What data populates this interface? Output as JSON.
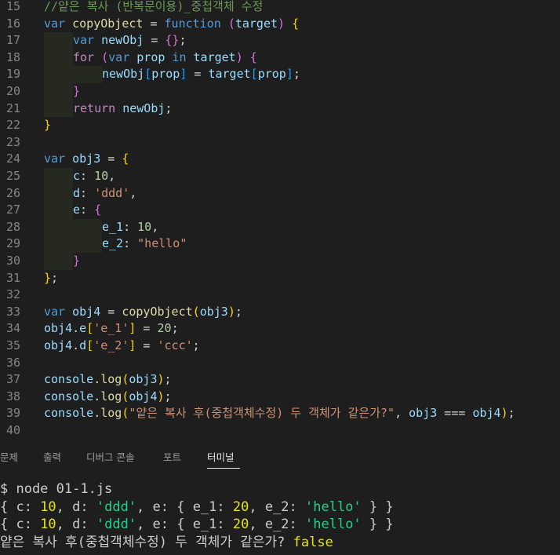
{
  "editor": {
    "lines": [
      {
        "num": "15",
        "tokens": [
          {
            "t": "//얕은 복사 (반복문이용)_중첩객체 수정",
            "c": "c"
          }
        ]
      },
      {
        "num": "16",
        "tokens": [
          {
            "t": "var ",
            "c": "k"
          },
          {
            "t": "copyObject",
            "c": "f"
          },
          {
            "t": " = ",
            "c": "p"
          },
          {
            "t": "function",
            "c": "k"
          },
          {
            "t": " ",
            "c": "p"
          },
          {
            "t": "(",
            "c": "b2"
          },
          {
            "t": "target",
            "c": "v"
          },
          {
            "t": ")",
            "c": "b2"
          },
          {
            "t": " ",
            "c": "p"
          },
          {
            "t": "{",
            "c": "b1"
          }
        ]
      },
      {
        "num": "17",
        "tokens": [
          {
            "t": "var ",
            "c": "k"
          },
          {
            "t": "newObj",
            "c": "v"
          },
          {
            "t": " = ",
            "c": "p"
          },
          {
            "t": "{}",
            "c": "b2"
          },
          {
            "t": ";",
            "c": "p"
          }
        ],
        "indent": 1
      },
      {
        "num": "18",
        "tokens": [
          {
            "t": "for",
            "c": "kw"
          },
          {
            "t": " ",
            "c": "p"
          },
          {
            "t": "(",
            "c": "b2"
          },
          {
            "t": "var ",
            "c": "k"
          },
          {
            "t": "prop",
            "c": "v"
          },
          {
            "t": " in ",
            "c": "k"
          },
          {
            "t": "target",
            "c": "v"
          },
          {
            "t": ")",
            "c": "b2"
          },
          {
            "t": " ",
            "c": "p"
          },
          {
            "t": "{",
            "c": "b2"
          }
        ],
        "indent": 1
      },
      {
        "num": "19",
        "tokens": [
          {
            "t": "newObj",
            "c": "v"
          },
          {
            "t": "[",
            "c": "b3"
          },
          {
            "t": "prop",
            "c": "v"
          },
          {
            "t": "]",
            "c": "b3"
          },
          {
            "t": " = ",
            "c": "p"
          },
          {
            "t": "target",
            "c": "v"
          },
          {
            "t": "[",
            "c": "b3"
          },
          {
            "t": "prop",
            "c": "v"
          },
          {
            "t": "]",
            "c": "b3"
          },
          {
            "t": ";",
            "c": "p"
          }
        ],
        "indent": 2
      },
      {
        "num": "20",
        "tokens": [
          {
            "t": "}",
            "c": "b2"
          }
        ],
        "indent": 1
      },
      {
        "num": "21",
        "tokens": [
          {
            "t": "return",
            "c": "kw"
          },
          {
            "t": " ",
            "c": "p"
          },
          {
            "t": "newObj",
            "c": "v"
          },
          {
            "t": ";",
            "c": "p"
          }
        ],
        "indent": 1
      },
      {
        "num": "22",
        "tokens": [
          {
            "t": "}",
            "c": "b1"
          }
        ]
      },
      {
        "num": "23",
        "tokens": []
      },
      {
        "num": "24",
        "tokens": [
          {
            "t": "var ",
            "c": "k"
          },
          {
            "t": "obj3",
            "c": "v"
          },
          {
            "t": " = ",
            "c": "p"
          },
          {
            "t": "{",
            "c": "b1"
          }
        ]
      },
      {
        "num": "25",
        "tokens": [
          {
            "t": "c",
            "c": "v"
          },
          {
            "t": ": ",
            "c": "p"
          },
          {
            "t": "10",
            "c": "n"
          },
          {
            "t": ",",
            "c": "p"
          }
        ],
        "indent": 1
      },
      {
        "num": "26",
        "tokens": [
          {
            "t": "d",
            "c": "v"
          },
          {
            "t": ": ",
            "c": "p"
          },
          {
            "t": "'ddd'",
            "c": "s"
          },
          {
            "t": ",",
            "c": "p"
          }
        ],
        "indent": 1
      },
      {
        "num": "27",
        "tokens": [
          {
            "t": "e",
            "c": "v"
          },
          {
            "t": ": ",
            "c": "p"
          },
          {
            "t": "{",
            "c": "b2"
          }
        ],
        "indent": 1
      },
      {
        "num": "28",
        "tokens": [
          {
            "t": "e_1",
            "c": "v"
          },
          {
            "t": ": ",
            "c": "p"
          },
          {
            "t": "10",
            "c": "n"
          },
          {
            "t": ",",
            "c": "p"
          }
        ],
        "indent": 2
      },
      {
        "num": "29",
        "tokens": [
          {
            "t": "e_2",
            "c": "v"
          },
          {
            "t": ": ",
            "c": "p"
          },
          {
            "t": "\"hello\"",
            "c": "s"
          }
        ],
        "indent": 2
      },
      {
        "num": "30",
        "tokens": [
          {
            "t": "}",
            "c": "b2"
          }
        ],
        "indent": 1
      },
      {
        "num": "31",
        "tokens": [
          {
            "t": "}",
            "c": "b1"
          },
          {
            "t": ";",
            "c": "p"
          }
        ]
      },
      {
        "num": "32",
        "tokens": []
      },
      {
        "num": "33",
        "tokens": [
          {
            "t": "var ",
            "c": "k"
          },
          {
            "t": "obj4",
            "c": "v"
          },
          {
            "t": " = ",
            "c": "p"
          },
          {
            "t": "copyObject",
            "c": "f"
          },
          {
            "t": "(",
            "c": "b1"
          },
          {
            "t": "obj3",
            "c": "v"
          },
          {
            "t": ")",
            "c": "b1"
          },
          {
            "t": ";",
            "c": "p"
          }
        ]
      },
      {
        "num": "34",
        "tokens": [
          {
            "t": "obj4",
            "c": "v"
          },
          {
            "t": ".",
            "c": "p"
          },
          {
            "t": "e",
            "c": "v"
          },
          {
            "t": "[",
            "c": "b1"
          },
          {
            "t": "'e_1'",
            "c": "s"
          },
          {
            "t": "]",
            "c": "b1"
          },
          {
            "t": " = ",
            "c": "p"
          },
          {
            "t": "20",
            "c": "n"
          },
          {
            "t": ";",
            "c": "p"
          }
        ]
      },
      {
        "num": "35",
        "tokens": [
          {
            "t": "obj4",
            "c": "v"
          },
          {
            "t": ".",
            "c": "p"
          },
          {
            "t": "d",
            "c": "v"
          },
          {
            "t": "[",
            "c": "b1"
          },
          {
            "t": "'e_2'",
            "c": "s"
          },
          {
            "t": "]",
            "c": "b1"
          },
          {
            "t": " = ",
            "c": "p"
          },
          {
            "t": "'ccc'",
            "c": "s"
          },
          {
            "t": ";",
            "c": "p"
          }
        ]
      },
      {
        "num": "36",
        "tokens": []
      },
      {
        "num": "37",
        "tokens": [
          {
            "t": "console",
            "c": "v"
          },
          {
            "t": ".",
            "c": "p"
          },
          {
            "t": "log",
            "c": "f"
          },
          {
            "t": "(",
            "c": "b1"
          },
          {
            "t": "obj3",
            "c": "v"
          },
          {
            "t": ")",
            "c": "b1"
          },
          {
            "t": ";",
            "c": "p"
          }
        ]
      },
      {
        "num": "38",
        "tokens": [
          {
            "t": "console",
            "c": "v"
          },
          {
            "t": ".",
            "c": "p"
          },
          {
            "t": "log",
            "c": "f"
          },
          {
            "t": "(",
            "c": "b1"
          },
          {
            "t": "obj4",
            "c": "v"
          },
          {
            "t": ")",
            "c": "b1"
          },
          {
            "t": ";",
            "c": "p"
          }
        ]
      },
      {
        "num": "39",
        "tokens": [
          {
            "t": "console",
            "c": "v"
          },
          {
            "t": ".",
            "c": "p"
          },
          {
            "t": "log",
            "c": "f"
          },
          {
            "t": "(",
            "c": "b1"
          },
          {
            "t": "\"얕은 복사 후(중첩객체수정) 두 객체가 같은가?\"",
            "c": "s"
          },
          {
            "t": ", ",
            "c": "p"
          },
          {
            "t": "obj3",
            "c": "v"
          },
          {
            "t": " === ",
            "c": "p"
          },
          {
            "t": "obj4",
            "c": "v"
          },
          {
            "t": ")",
            "c": "b1"
          },
          {
            "t": ";",
            "c": "p"
          }
        ]
      },
      {
        "num": "40",
        "tokens": []
      }
    ]
  },
  "panel": {
    "tabs": [
      {
        "label": "문제",
        "active": false
      },
      {
        "label": "출력",
        "active": false
      },
      {
        "label": "디버그 콘솔",
        "active": false
      },
      {
        "label": "포트",
        "active": false
      },
      {
        "label": "터미널",
        "active": true
      }
    ]
  },
  "terminal": {
    "lines": [
      [
        {
          "t": "$ node 01-1.js",
          "c": ""
        }
      ],
      [
        {
          "t": "{ c: ",
          "c": ""
        },
        {
          "t": "10",
          "c": "t-num"
        },
        {
          "t": ", d: ",
          "c": ""
        },
        {
          "t": "'ddd'",
          "c": "t-str"
        },
        {
          "t": ", e: { e_1: ",
          "c": ""
        },
        {
          "t": "20",
          "c": "t-num"
        },
        {
          "t": ", e_2: ",
          "c": ""
        },
        {
          "t": "'hello'",
          "c": "t-str"
        },
        {
          "t": " } }",
          "c": ""
        }
      ],
      [
        {
          "t": "{ c: ",
          "c": ""
        },
        {
          "t": "10",
          "c": "t-num"
        },
        {
          "t": ", d: ",
          "c": ""
        },
        {
          "t": "'ddd'",
          "c": "t-str"
        },
        {
          "t": ", e: { e_1: ",
          "c": ""
        },
        {
          "t": "20",
          "c": "t-num"
        },
        {
          "t": ", e_2: ",
          "c": ""
        },
        {
          "t": "'hello'",
          "c": "t-str"
        },
        {
          "t": " } }",
          "c": ""
        }
      ],
      [
        {
          "t": "얕은 복사 후(중첩객체수정) 두 객체가 같은가? ",
          "c": ""
        },
        {
          "t": "false",
          "c": "t-bool"
        }
      ]
    ]
  },
  "colors": {
    "background": "#1e1e1e",
    "keyword": "#569cd6",
    "control": "#c586c0",
    "function": "#dcdcaa",
    "variable": "#9cdcfe",
    "number": "#b5cea8",
    "string": "#ce9178",
    "comment": "#6a9955",
    "terminal_string": "#23d18b",
    "terminal_number": "#e5e510"
  }
}
